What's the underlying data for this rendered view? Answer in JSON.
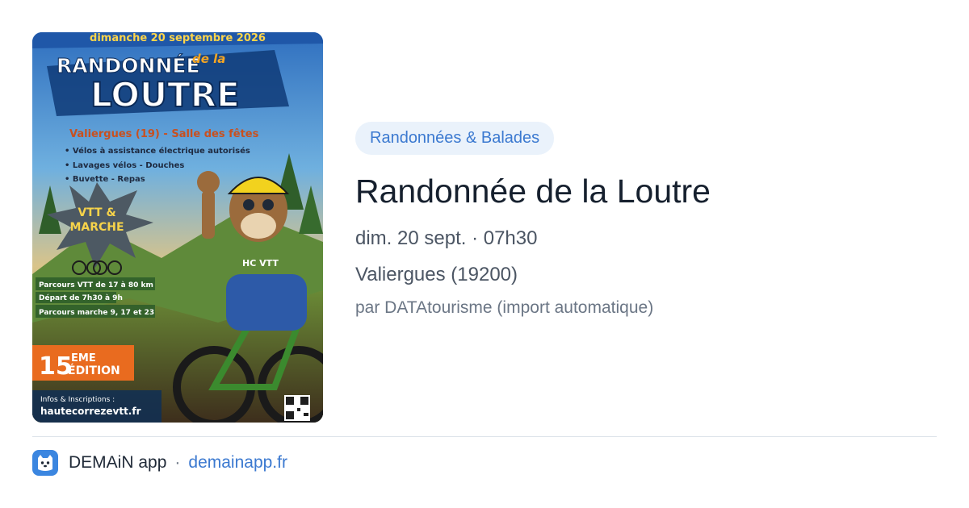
{
  "poster": {
    "date_banner": "dimanche 20 septembre 2026",
    "title_line1": "RANDONNÉE",
    "title_small": "de la",
    "title_line2": "LOUTRE",
    "location": "Valiergues (19) - Salle des fêtes",
    "bullets": [
      "• Vélos à assistance électrique autorisés",
      "• Lavages vélos - Douches",
      "• Buvette - Repas"
    ],
    "badge_line1": "VTT &",
    "badge_line2": "MARCHE",
    "shirt_text": "HC VTT",
    "parcours": [
      "Parcours VTT de 17 à 80 km",
      "Départ de 7h30 à 9h",
      "Parcours marche 9, 17 et 23"
    ],
    "edition_number": "15",
    "edition_sup": "EME",
    "edition_word": "ÉDITION",
    "infos_label": "Infos & Inscriptions :",
    "website": "hautecorrezevtt.fr"
  },
  "event": {
    "category": "Randonnées & Balades",
    "title": "Randonnée de la Loutre",
    "datetime": "dim. 20 sept. · 07h30",
    "place": "Valiergues (19200)",
    "source": "par DATAtourisme (import automatique)"
  },
  "footer": {
    "app_name": "DEMAiN app",
    "separator": "·",
    "link": "demainapp.fr",
    "icon": "demain-app-icon"
  }
}
